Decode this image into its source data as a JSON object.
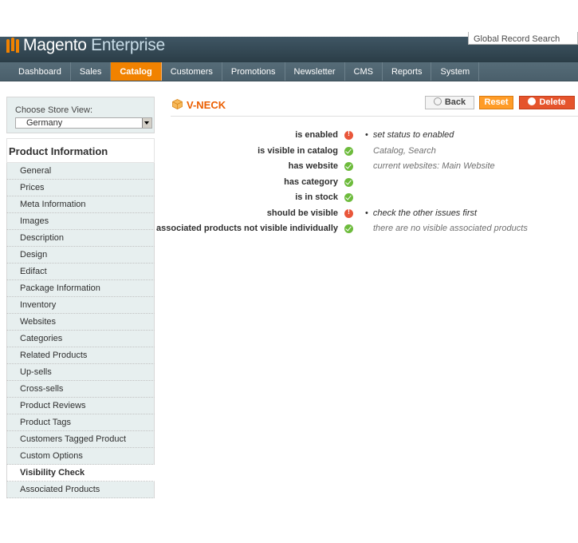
{
  "header": {
    "brand": "Magento",
    "brand_suffix": "Enterprise",
    "global_search_placeholder": "Global Record Search"
  },
  "nav": {
    "items": [
      "Dashboard",
      "Sales",
      "Catalog",
      "Customers",
      "Promotions",
      "Newsletter",
      "CMS",
      "Reports",
      "System"
    ],
    "active": "Catalog"
  },
  "store_switcher": {
    "label": "Choose Store View:",
    "selected": "Germany"
  },
  "sidebar": {
    "title": "Product Information",
    "tabs": [
      "General",
      "Prices",
      "Meta Information",
      "Images",
      "Description",
      "Design",
      "Edifact",
      "Package Information",
      "Inventory",
      "Websites",
      "Categories",
      "Related Products",
      "Up-sells",
      "Cross-sells",
      "Product Reviews",
      "Product Tags",
      "Customers Tagged Product",
      "Custom Options",
      "Visibility Check",
      "Associated Products"
    ],
    "active_tab": "Visibility Check"
  },
  "page": {
    "title": "V-NECK",
    "buttons": {
      "back": "Back",
      "reset": "Reset",
      "delete": "Delete"
    }
  },
  "checks": [
    {
      "label": "is enabled",
      "status": "error",
      "note": "set status to enabled",
      "bullet": true
    },
    {
      "label": "is visible in catalog",
      "status": "ok",
      "note": "Catalog, Search",
      "bullet": false
    },
    {
      "label": "has website",
      "status": "ok",
      "note": "current websites: Main Website",
      "bullet": false
    },
    {
      "label": "has category",
      "status": "ok",
      "note": "",
      "bullet": false
    },
    {
      "label": "is in stock",
      "status": "ok",
      "note": "",
      "bullet": false
    },
    {
      "label": "should be visible",
      "status": "error",
      "note": "check the other issues first",
      "bullet": true
    },
    {
      "label": "associated products not visible individually",
      "status": "ok",
      "note": "there are no visible associated products",
      "bullet": false
    }
  ],
  "colors": {
    "accent": "#f18200",
    "title": "#eb5e00",
    "ok": "#6dbb3c",
    "error": "#e9563a"
  }
}
